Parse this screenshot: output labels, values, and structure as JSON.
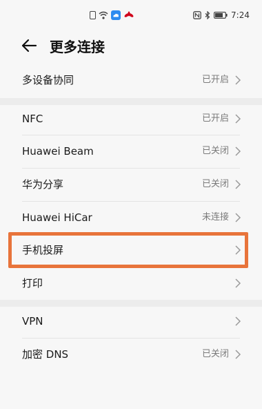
{
  "status_bar": {
    "time": "7:24",
    "icons": [
      "sim-icon",
      "wifi-icon",
      "cloud-icon",
      "huawei-flower-icon",
      "nfc-icon",
      "bluetooth-icon",
      "battery-icon"
    ]
  },
  "header": {
    "back_icon": "back-arrow-icon",
    "title": "更多连接"
  },
  "sections": [
    {
      "items": [
        {
          "label": "多设备协同",
          "status": "已开启"
        }
      ]
    },
    {
      "items": [
        {
          "label": "NFC",
          "status": "已开启"
        },
        {
          "label": "Huawei Beam",
          "status": "已关闭"
        },
        {
          "label": "华为分享",
          "status": "已关闭"
        },
        {
          "label": "Huawei HiCar",
          "status": "未连接"
        },
        {
          "label": "手机投屏",
          "status": ""
        },
        {
          "label": "打印",
          "status": ""
        }
      ]
    },
    {
      "items": [
        {
          "label": "VPN",
          "status": ""
        },
        {
          "label": "加密 DNS",
          "status": "已关闭"
        }
      ]
    }
  ],
  "colors": {
    "highlight": "#e8743b",
    "background": "#f7f7f7",
    "section_gap": "#ececec",
    "secondary_text": "#7a7a7a"
  }
}
